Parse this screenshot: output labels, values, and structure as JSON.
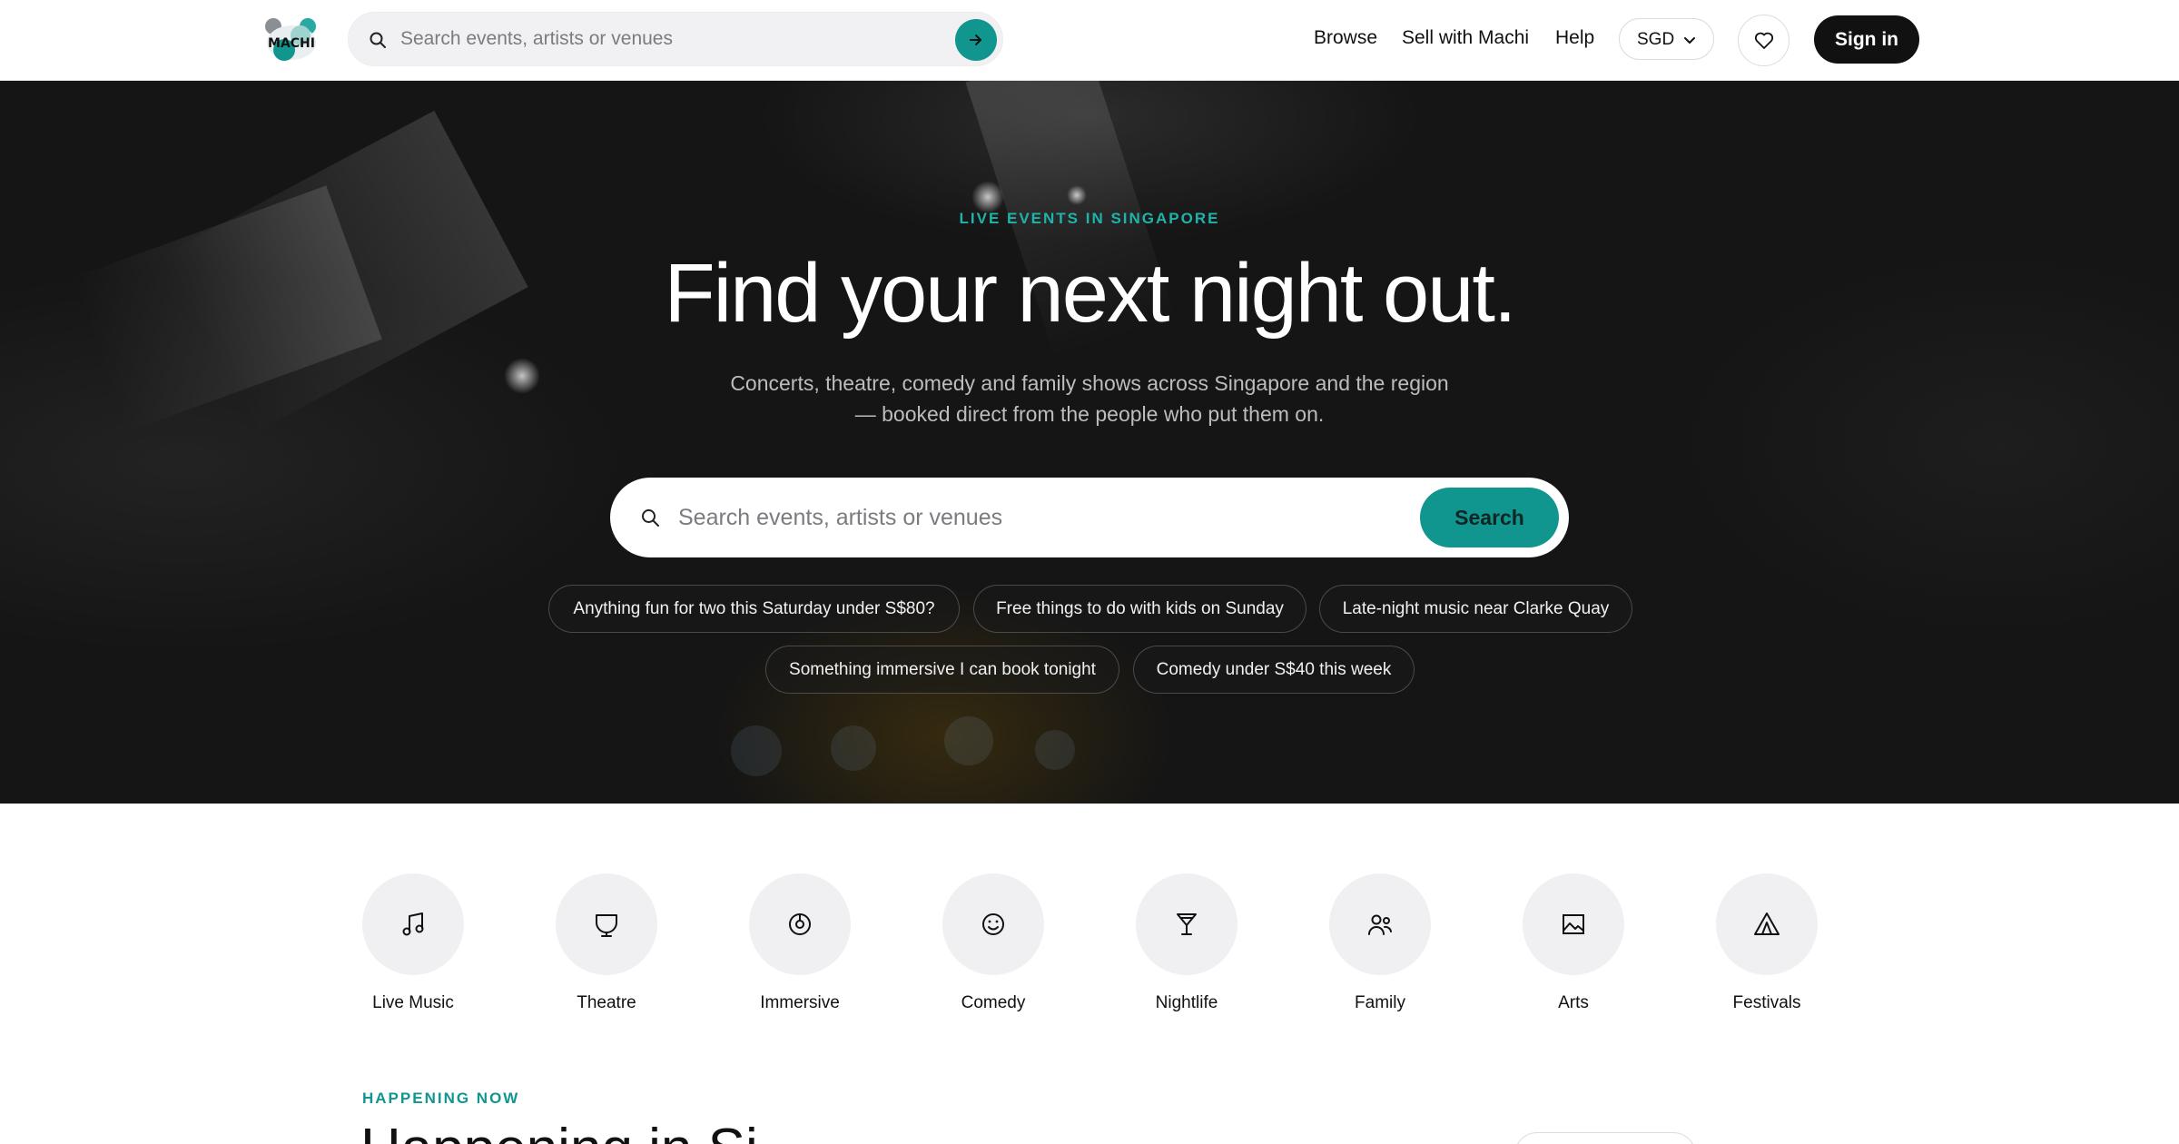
{
  "header": {
    "logo_text": "MACHI",
    "search_placeholder": "Search events, artists or venues",
    "nav": [
      "Browse",
      "Sell with Machi",
      "Help"
    ],
    "currency": "SGD",
    "signin_label": "Sign in"
  },
  "hero": {
    "eyebrow": "LIVE EVENTS IN SINGAPORE",
    "title": "Find your next night out.",
    "subtitle": "Concerts, theatre, comedy and family shows across Singapore and the region — booked direct from the people who put them on.",
    "search_placeholder": "Search events, artists or venues",
    "search_button": "Search",
    "suggestions": [
      "Anything fun for two this Saturday under S$80?",
      "Free things to do with kids on Sunday",
      "Late-night music near Clarke Quay",
      "Something immersive I can book tonight",
      "Comedy under S$40 this week"
    ]
  },
  "categories": [
    {
      "label": "Live Music",
      "icon": "music-note-icon"
    },
    {
      "label": "Theatre",
      "icon": "theatre-mask-icon"
    },
    {
      "label": "Immersive",
      "icon": "immersive-icon"
    },
    {
      "label": "Comedy",
      "icon": "smiley-icon"
    },
    {
      "label": "Nightlife",
      "icon": "cocktail-icon"
    },
    {
      "label": "Family",
      "icon": "family-icon"
    },
    {
      "label": "Arts",
      "icon": "image-icon"
    },
    {
      "label": "Festivals",
      "icon": "tent-icon"
    }
  ],
  "section": {
    "eyebrow": "HAPPENING NOW",
    "title": "Happening in Si"
  },
  "colors": {
    "accent": "#11968f",
    "eyebrow_teal": "#1fb3aa",
    "dark": "#111111"
  }
}
